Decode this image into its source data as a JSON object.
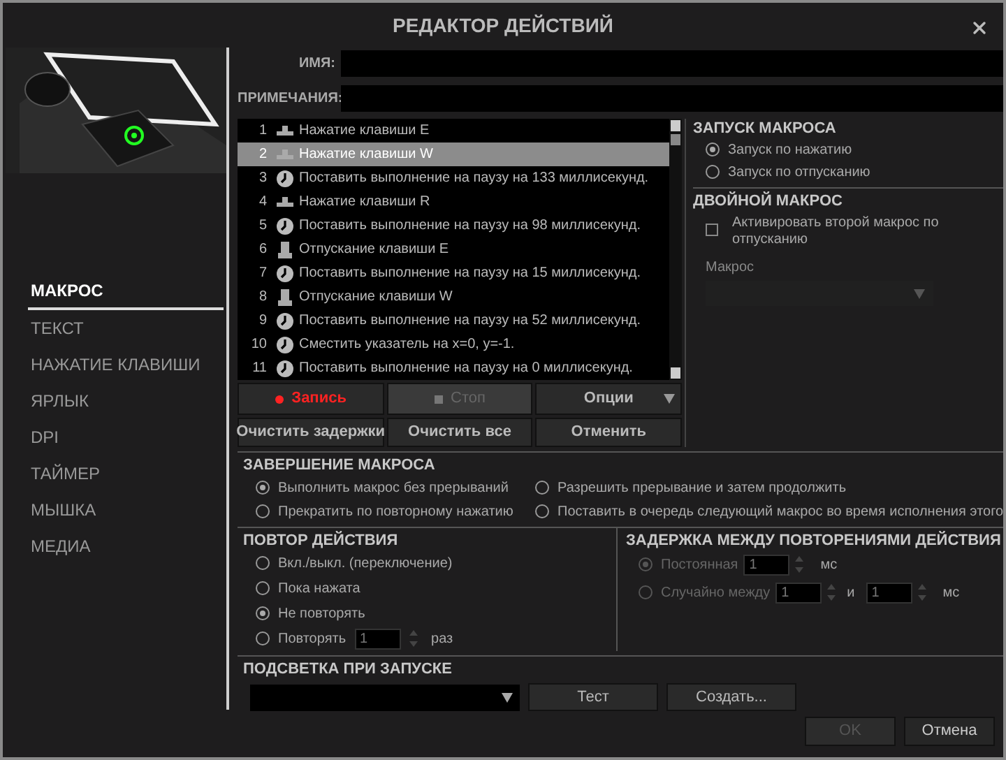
{
  "window": {
    "title": "РЕДАКТОР ДЕЙСТВИЙ"
  },
  "sidebar": {
    "items": [
      {
        "label": "МАКРОС",
        "selected": true
      },
      {
        "label": "ТЕКСТ",
        "selected": false
      },
      {
        "label": "НАЖАТИЕ КЛАВИШИ",
        "selected": false
      },
      {
        "label": "ЯРЛЫК",
        "selected": false
      },
      {
        "label": "DPI",
        "selected": false
      },
      {
        "label": "ТАЙМЕР",
        "selected": false
      },
      {
        "label": "МЫШКА",
        "selected": false
      },
      {
        "label": "МЕДИА",
        "selected": false
      }
    ]
  },
  "fields": [
    {
      "label": "ИМЯ:"
    },
    {
      "label": "ПРИМЕЧАНИЯ:"
    }
  ],
  "actions": [
    {
      "index": "1",
      "kind": "press",
      "text": "Нажатие клавиши E",
      "selected": false
    },
    {
      "index": "2",
      "kind": "press",
      "text": "Нажатие клавиши W",
      "selected": true
    },
    {
      "index": "3",
      "kind": "pause",
      "text": "Поставить выполнение на паузу на 133 миллисекунд.",
      "selected": false
    },
    {
      "index": "4",
      "kind": "press",
      "text": "Нажатие клавиши R",
      "selected": false
    },
    {
      "index": "5",
      "kind": "pause",
      "text": "Поставить выполнение на паузу на 98 миллисекунд.",
      "selected": false
    },
    {
      "index": "6",
      "kind": "release",
      "text": "Отпускание клавиши E",
      "selected": false
    },
    {
      "index": "7",
      "kind": "pause",
      "text": "Поставить выполнение на паузу на 15 миллисекунд.",
      "selected": false
    },
    {
      "index": "8",
      "kind": "release",
      "text": "Отпускание клавиши W",
      "selected": false
    },
    {
      "index": "9",
      "kind": "pause",
      "text": "Поставить выполнение на паузу на 52 миллисекунд.",
      "selected": false
    },
    {
      "index": "10",
      "kind": "pause",
      "text": "Сместить указатель на x=0, y=-1.",
      "selected": false
    },
    {
      "index": "11",
      "kind": "pause",
      "text": "Поставить выполнение на паузу на 0 миллисекунд.",
      "selected": false
    }
  ],
  "record_buttons": [
    {
      "kind": "record",
      "label": "Запись",
      "disabled": false
    },
    {
      "kind": "stop",
      "label": "Стоп",
      "disabled": true
    },
    {
      "kind": "options",
      "label": "Опции",
      "disabled": false
    }
  ],
  "edit_buttons": [
    "Очистить задержки",
    "Очистить все",
    "Отменить"
  ],
  "launch": {
    "title": "ЗАПУСК МАКРОСА",
    "options": [
      {
        "label": "Запуск по нажатию",
        "selected": true
      },
      {
        "label": "Запуск по отпусканию",
        "selected": false
      }
    ]
  },
  "double_macro": {
    "title": "ДВОЙНОЙ МАКРОС",
    "checkbox": {
      "label": "Активировать второй макрос по отпусканию",
      "checked": false
    },
    "macro_label": "Макрос"
  },
  "completion": {
    "title": "ЗАВЕРШЕНИЕ МАКРОСА",
    "options": [
      {
        "label": "Выполнить макрос без прерываний",
        "selected": true
      },
      {
        "label": "Разрешить прерывание и затем продолжить",
        "selected": false
      },
      {
        "label": "Прекратить по повторному нажатию",
        "selected": false
      },
      {
        "label": "Поставить в очередь следующий макрос во время исполнения этого",
        "selected": false
      }
    ]
  },
  "repeat": {
    "title": "ПОВТОР ДЕЙСТВИЯ",
    "options": [
      {
        "kind": "plain",
        "label": "Вкл./выкл. (переключение)",
        "selected": false
      },
      {
        "kind": "plain",
        "label": "Пока нажата",
        "selected": false
      },
      {
        "kind": "plain",
        "label": "Не повторять",
        "selected": true
      },
      {
        "kind": "count",
        "label": "Повторять",
        "selected": false,
        "value": "1",
        "unit": "раз"
      }
    ]
  },
  "delay": {
    "title": "ЗАДЕРЖКА МЕЖДУ ПОВТОРЕНИЯМИ ДЕЙСТВИЯ",
    "disabled": true,
    "options": [
      {
        "label": "Постоянная",
        "selected": true,
        "values": [
          "1"
        ],
        "unit": "мс"
      },
      {
        "label": "Случайно между",
        "selected": false,
        "values": [
          "1",
          "1"
        ],
        "joiner": "и",
        "unit": "мс"
      }
    ]
  },
  "lighting": {
    "title": "ПОДСВЕТКА ПРИ ЗАПУСКЕ",
    "buttons": [
      "Тест",
      "Создать..."
    ]
  },
  "footer": [
    {
      "label": "OK",
      "disabled": true
    },
    {
      "label": "Отмена",
      "disabled": false
    }
  ]
}
